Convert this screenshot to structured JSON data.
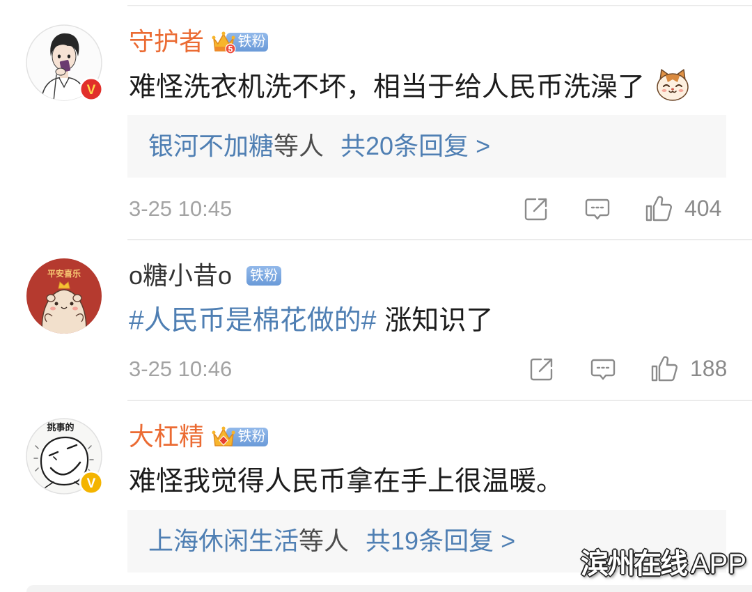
{
  "colors": {
    "username_vip": "#eb6b33",
    "link": "#4f7fb3",
    "text": "#1c1c1c",
    "muted": "#a3a3a3",
    "icon": "#8a8a8a",
    "reply_bg": "#f7f7f7",
    "divider": "#ebebeb"
  },
  "comments": [
    {
      "username": "守护者",
      "vip": true,
      "avatar_icon": "boy-avatar",
      "verified": {
        "icon": "verified-red-icon",
        "label": "V"
      },
      "fan_badge": {
        "icon": "crown-icon",
        "level": "5",
        "label": "铁粉"
      },
      "text": "难怪洗衣机洗不坏，相当于给人民币洗澡了",
      "emoji": "cat-face-emoji",
      "replies": {
        "names": "银河不加糖",
        "suffix": "等人",
        "count": "共20条回复 >"
      },
      "time": "3-25 10:45",
      "actions": {
        "share_icon": "share-icon",
        "comment_icon": "comment-icon",
        "like_icon": "thumbs-up-icon",
        "likes": "404"
      }
    },
    {
      "username": "o糖小昔o",
      "vip": false,
      "avatar_icon": "hamster-avatar",
      "avatar_text": "平安喜乐",
      "fan_badge": {
        "label": "铁粉"
      },
      "hashtag": "#人民币是棉花做的#",
      "text": "涨知识了",
      "time": "3-25 10:46",
      "actions": {
        "share_icon": "share-icon",
        "comment_icon": "comment-icon",
        "like_icon": "thumbs-up-icon",
        "likes": "188"
      }
    },
    {
      "username": "大杠精",
      "vip": true,
      "avatar_icon": "sketch-face-avatar",
      "avatar_text": "挑事的",
      "verified": {
        "icon": "verified-yellow-icon",
        "label": "V"
      },
      "fan_badge": {
        "icon": "crown-gem-icon",
        "label": "铁粉"
      },
      "text": "难怪我觉得人民币拿在手上很温暖。",
      "replies": {
        "names": "上海休闲生活",
        "suffix": "等人",
        "count": "共19条回复 >"
      }
    }
  ],
  "watermark": {
    "brand": "滨州在线",
    "suffix": "APP"
  }
}
